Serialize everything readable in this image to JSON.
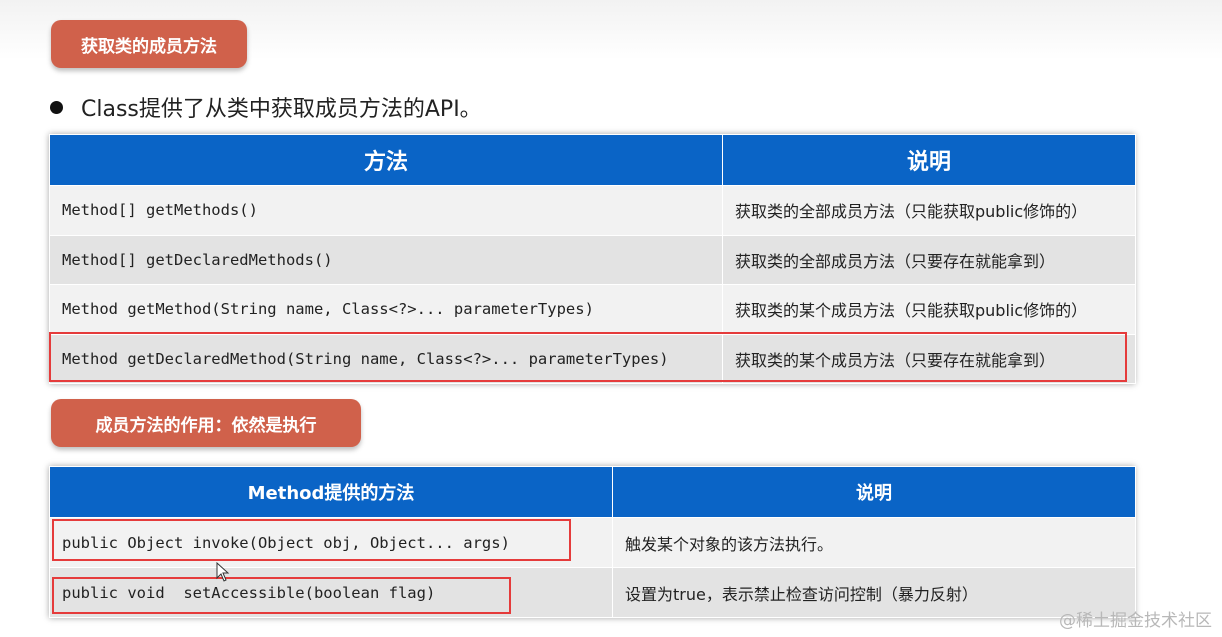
{
  "badge_top": "获取类的成员方法",
  "bullet_text": "Class提供了从类中获取成员方法的API。",
  "table1": {
    "headers": [
      "方法",
      "说明"
    ],
    "rows": [
      {
        "method": "Method[] getMethods()",
        "desc": "获取类的全部成员方法（只能获取public修饰的）"
      },
      {
        "method": "Method[] getDeclaredMethods()",
        "desc": "获取类的全部成员方法（只要存在就能拿到）"
      },
      {
        "method": "Method getMethod(String name, Class<?>... parameterTypes)",
        "desc": "获取类的某个成员方法（只能获取public修饰的）"
      },
      {
        "method": "Method getDeclaredMethod(String name, Class<?>... parameterTypes)",
        "desc": "获取类的某个成员方法（只要存在就能拿到）"
      }
    ]
  },
  "badge_middle": "成员方法的作用：依然是执行",
  "table2": {
    "headers": [
      "Method提供的方法",
      "说明"
    ],
    "rows": [
      {
        "method": "public Object invoke(Object obj, Object... args)",
        "desc": "触发某个对象的该方法执行。"
      },
      {
        "method": "public void  setAccessible(boolean flag)",
        "desc": "设置为true，表示禁止检查访问控制（暴力反射）"
      }
    ]
  },
  "watermark": "@稀土掘金技术社区",
  "colors": {
    "header_blue": "#0a64c6",
    "badge_red": "#d0614b",
    "highlight_red": "#e53b3b"
  },
  "icons": {
    "cursor": "mouse-pointer-icon",
    "bullet": "bullet-dot-icon"
  }
}
